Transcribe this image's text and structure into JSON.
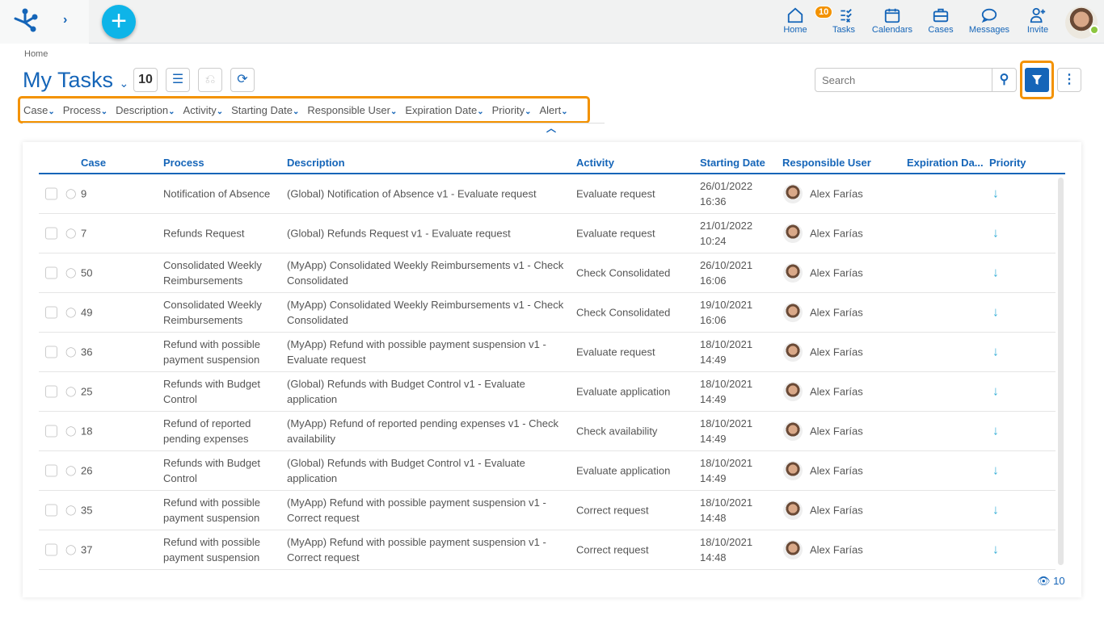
{
  "topbar": {
    "nav": [
      {
        "label": "Home",
        "icon": "home-icon"
      },
      {
        "label": "Tasks",
        "icon": "tasks-icon",
        "badge": "10"
      },
      {
        "label": "Calendars",
        "icon": "calendar-icon"
      },
      {
        "label": "Cases",
        "icon": "briefcase-icon"
      },
      {
        "label": "Messages",
        "icon": "message-icon"
      },
      {
        "label": "Invite",
        "icon": "invite-icon"
      }
    ],
    "status_color": "#8cc63f",
    "accent": "#1565b8",
    "badge_color": "#f39200"
  },
  "breadcrumb": "Home",
  "page": {
    "title": "My Tasks",
    "count": "10",
    "search_placeholder": "Search"
  },
  "column_chooser": [
    "Case",
    "Process",
    "Description",
    "Activity",
    "Starting Date",
    "Responsible User",
    "Expiration Date",
    "Priority",
    "Alert"
  ],
  "table": {
    "headers": [
      "Case",
      "Process",
      "Description",
      "Activity",
      "Starting Date",
      "Responsible User",
      "Expiration Da...",
      "Priority"
    ],
    "rows": [
      {
        "case": "9",
        "process": "Notification of Absence",
        "description": "(Global) Notification of Absence v1 - Evaluate request",
        "activity": "Evaluate request",
        "date": "26/01/2022",
        "time": "16:36",
        "user": "Alex Farías",
        "priority": "↓"
      },
      {
        "case": "7",
        "process": "Refunds Request",
        "description": "(Global) Refunds Request v1 - Evaluate request",
        "activity": "Evaluate request",
        "date": "21/01/2022",
        "time": "10:24",
        "user": "Alex Farías",
        "priority": "↓"
      },
      {
        "case": "50",
        "process": "Consolidated Weekly Reimbursements",
        "description": "(MyApp) Consolidated Weekly Reimbursements v1 - Check Consolidated",
        "activity": "Check Consolidated",
        "date": "26/10/2021",
        "time": "16:06",
        "user": "Alex Farías",
        "priority": "↓"
      },
      {
        "case": "49",
        "process": "Consolidated Weekly Reimbursements",
        "description": "(MyApp) Consolidated Weekly Reimbursements v1 - Check Consolidated",
        "activity": "Check Consolidated",
        "date": "19/10/2021",
        "time": "16:06",
        "user": "Alex Farías",
        "priority": "↓"
      },
      {
        "case": "36",
        "process": "Refund with possible payment suspension",
        "description": "(MyApp) Refund with possible payment suspension v1 - Evaluate request",
        "activity": "Evaluate request",
        "date": "18/10/2021",
        "time": "14:49",
        "user": "Alex Farías",
        "priority": "↓"
      },
      {
        "case": "25",
        "process": "Refunds with Budget Control",
        "description": "(Global) Refunds with Budget Control v1 - Evaluate application",
        "activity": "Evaluate application",
        "date": "18/10/2021",
        "time": "14:49",
        "user": "Alex Farías",
        "priority": "↓"
      },
      {
        "case": "18",
        "process": "Refund of reported pending expenses",
        "description": "(MyApp) Refund of reported pending expenses v1 - Check availability",
        "activity": "Check availability",
        "date": "18/10/2021",
        "time": "14:49",
        "user": "Alex Farías",
        "priority": "↓"
      },
      {
        "case": "26",
        "process": "Refunds with Budget Control",
        "description": "(Global) Refunds with Budget Control v1 - Evaluate application",
        "activity": "Evaluate application",
        "date": "18/10/2021",
        "time": "14:49",
        "user": "Alex Farías",
        "priority": "↓"
      },
      {
        "case": "35",
        "process": "Refund with possible payment suspension",
        "description": "(MyApp) Refund with possible payment suspension v1 - Correct request",
        "activity": "Correct request",
        "date": "18/10/2021",
        "time": "14:48",
        "user": "Alex Farías",
        "priority": "↓"
      },
      {
        "case": "37",
        "process": "Refund with possible payment suspension",
        "description": "(MyApp) Refund with possible payment suspension v1 - Correct request",
        "activity": "Correct request",
        "date": "18/10/2021",
        "time": "14:48",
        "user": "Alex Farías",
        "priority": "↓"
      }
    ]
  },
  "footer": {
    "visible_count": "10"
  }
}
